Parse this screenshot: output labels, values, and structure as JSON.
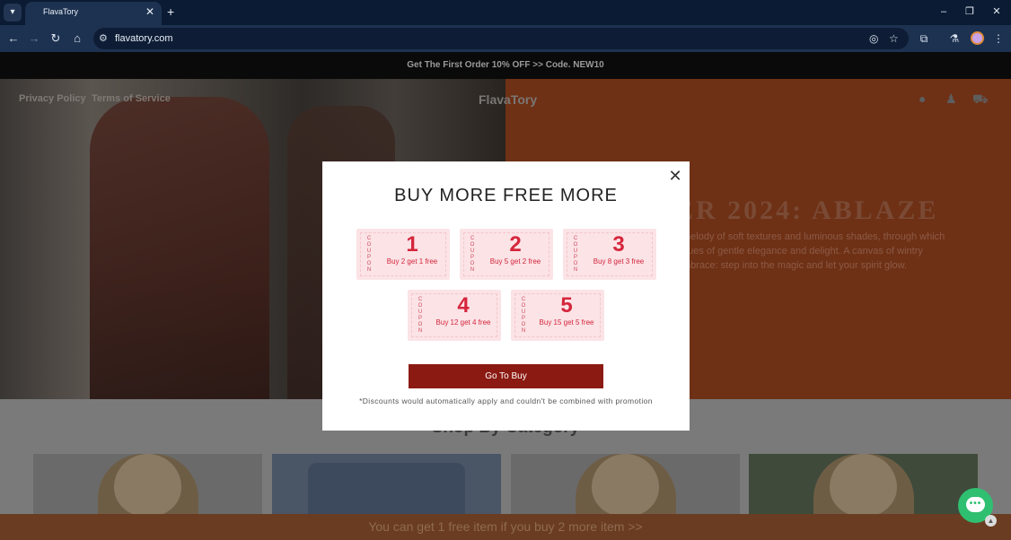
{
  "browser": {
    "tab_title": "FlavaTory",
    "url": "flavatory.com"
  },
  "announcement": "Get The First Order 10% OFF >> Code. NEW10",
  "site_nav": {
    "links": [
      "Privacy Policy",
      "Terms of Service"
    ],
    "logo": "FlavaTory"
  },
  "hero": {
    "heading": "ER 2024: ABLAZE",
    "lines": [
      "melody of soft textures and luminous shades, through which",
      "hues of gentle elegance and delight. A canvas of wintry",
      "mbrace: step into the magic and let your spirit glow."
    ]
  },
  "category_section": {
    "title": "Shop By Category"
  },
  "bottom_bar": {
    "text": "You can get 1 free item if you buy 2 more item  >>"
  },
  "modal": {
    "title": "BUY MORE FREE MORE",
    "coupon_word": "COUPON",
    "coupons": [
      {
        "number": "1",
        "desc": "Buy 2 get 1 free"
      },
      {
        "number": "2",
        "desc": "Buy 5 get 2 free"
      },
      {
        "number": "3",
        "desc": "Buy 8 get 3 free"
      },
      {
        "number": "4",
        "desc": "Buy 12 get 4 free"
      },
      {
        "number": "5",
        "desc": "Buy 15 get 5 free"
      }
    ],
    "button_label": "Go To Buy",
    "disclaimer": "*Discounts would automatically apply and couldn't be combined with promotion"
  },
  "colors": {
    "coupon_red": "#d5263c",
    "button_red": "#8b1a12",
    "hero_brown": "#6e3116",
    "chat_green": "#2fbf71"
  }
}
